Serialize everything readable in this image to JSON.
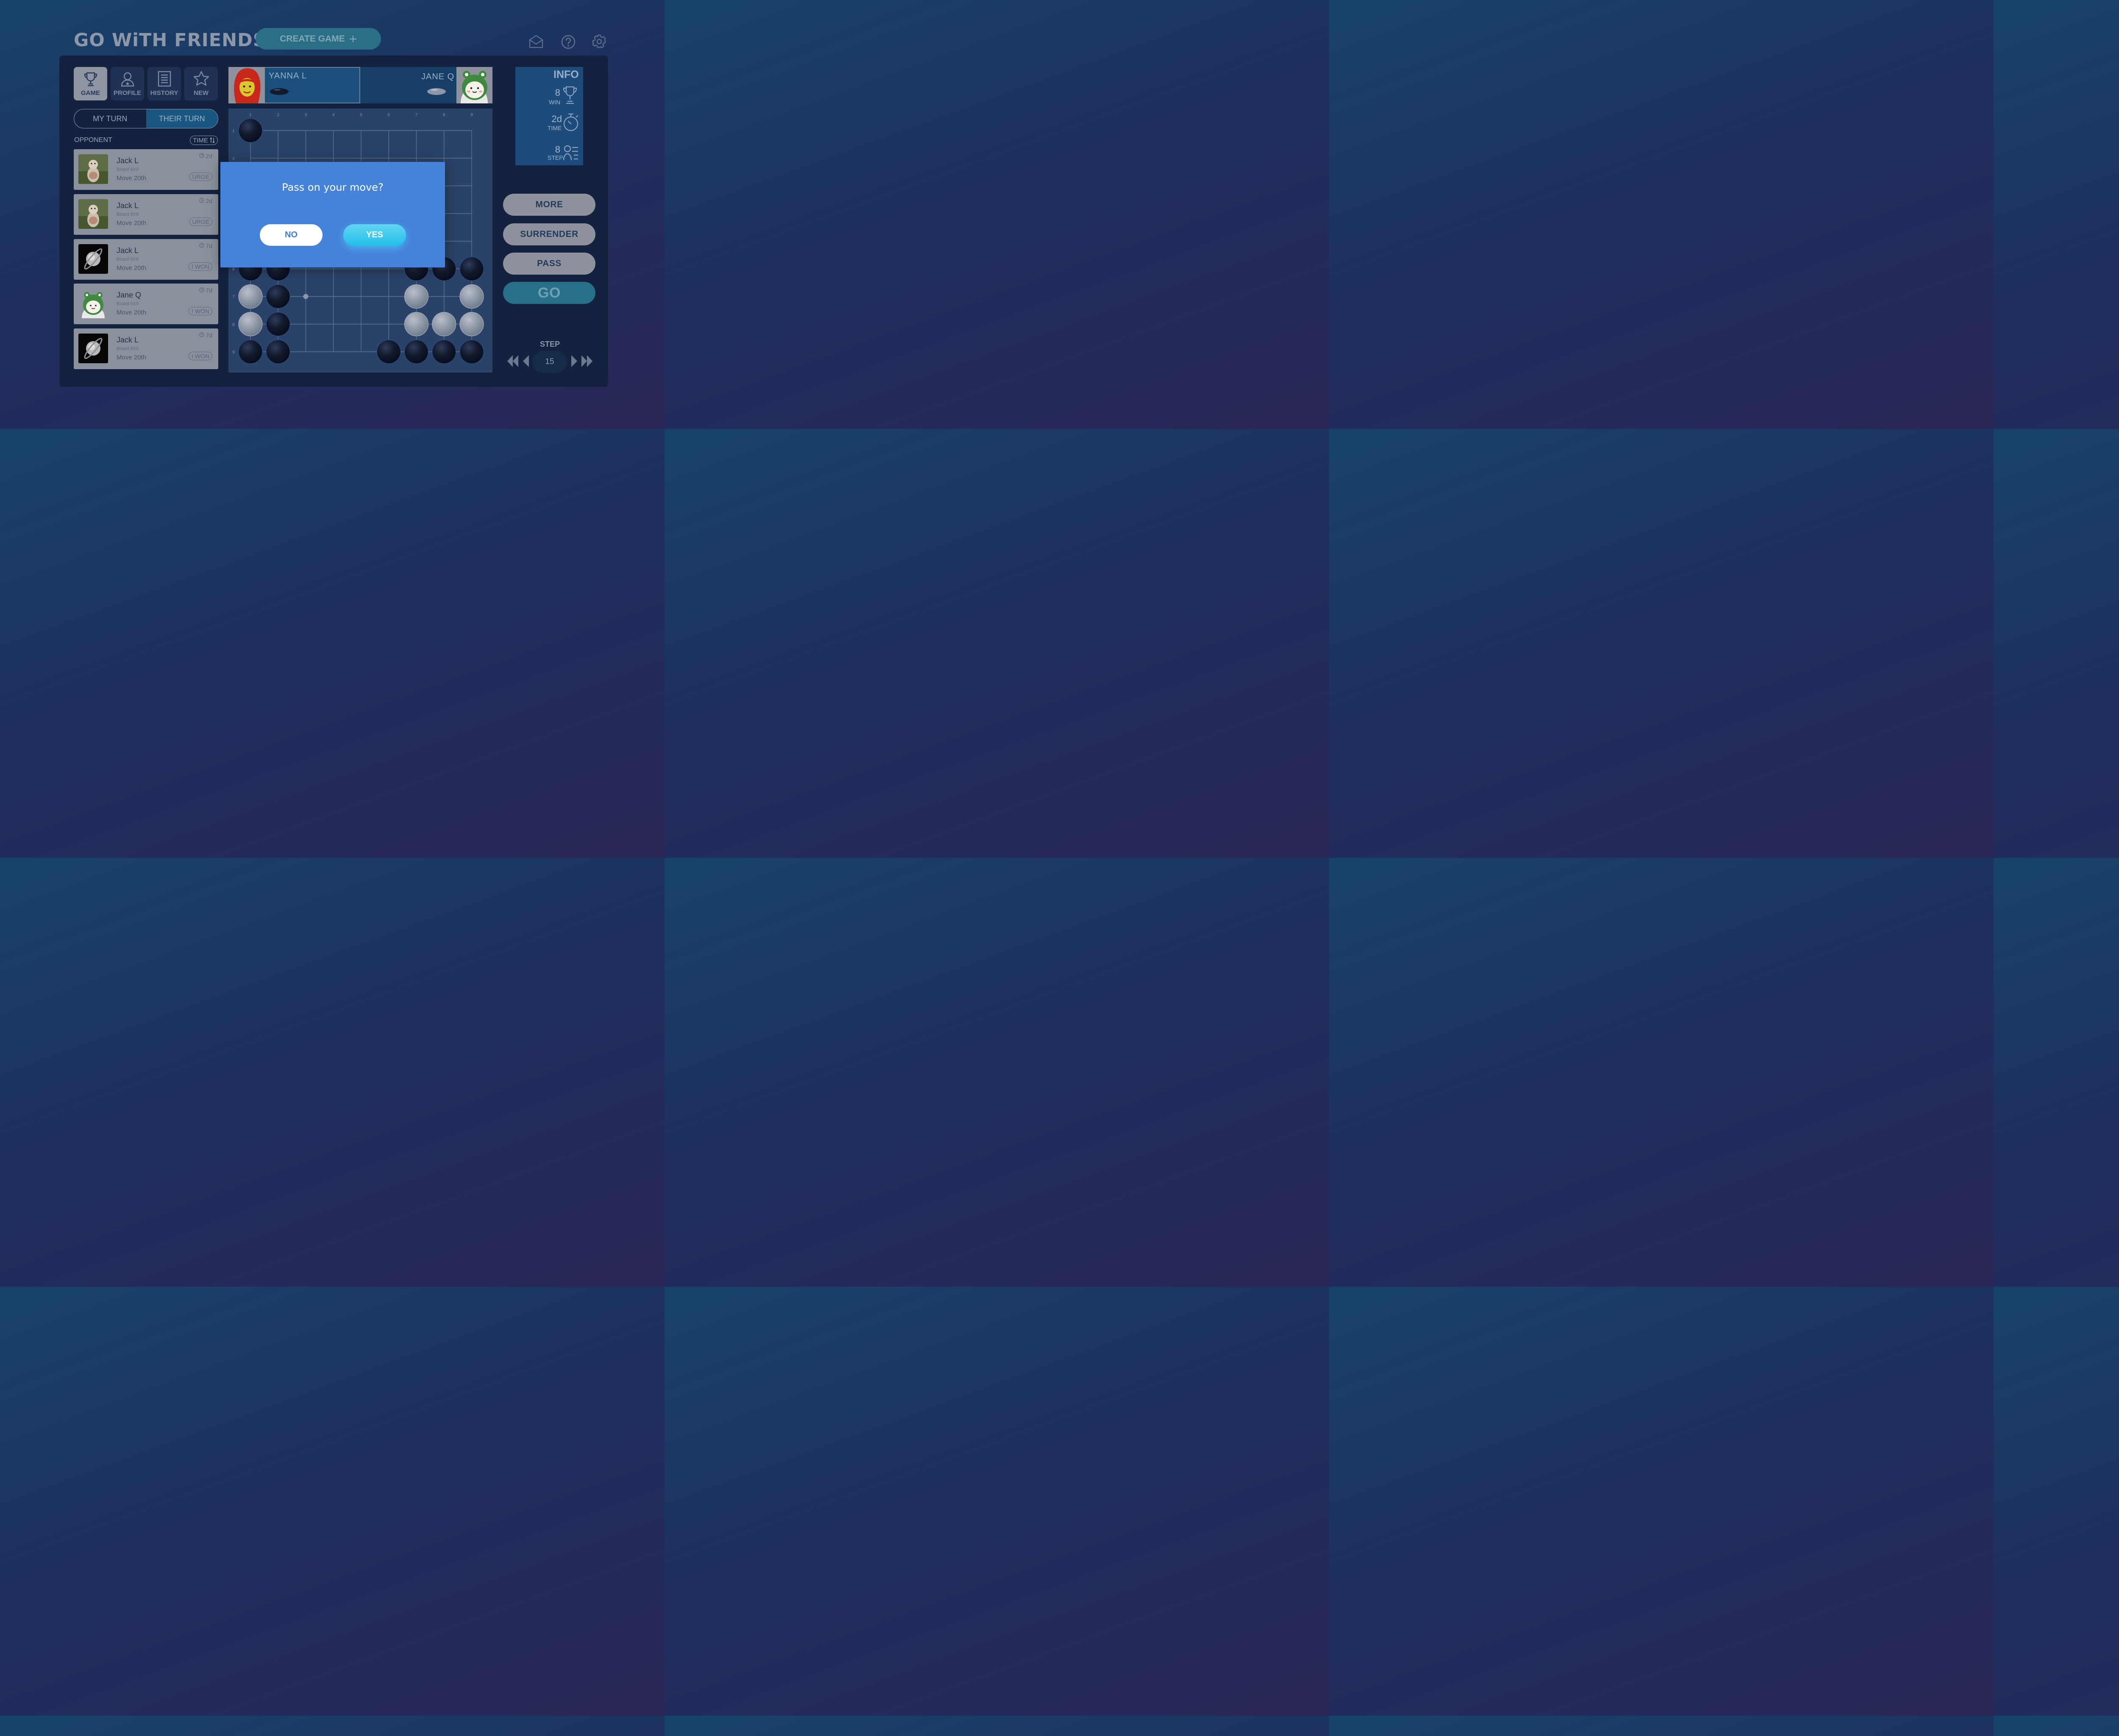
{
  "app": {
    "title": "GO WiTH FRIENDS",
    "create_label": "CREATE GAME",
    "create_icon": "plus-icon"
  },
  "top_icons": [
    "mail-icon",
    "help-icon",
    "settings-icon"
  ],
  "tabs": [
    {
      "label": "GAME",
      "icon": "trophy-icon",
      "active": true
    },
    {
      "label": "PROFILE",
      "icon": "person-icon",
      "active": false
    },
    {
      "label": "HISTORY",
      "icon": "document-icon",
      "active": false
    },
    {
      "label": "NEW",
      "icon": "star-icon",
      "active": false
    }
  ],
  "turn_toggle": {
    "my_turn": "MY TURN",
    "their_turn": "THEIR TURN",
    "selected": "THEIR TURN"
  },
  "list": {
    "opponent_label": "OPPONENT",
    "sort_label": "TIME"
  },
  "games": [
    {
      "name": "Jack L",
      "board": "Board 9X9",
      "move": "Move 20th",
      "time": "2d",
      "status": "URGE",
      "avatar": "dog"
    },
    {
      "name": "Jack L",
      "board": "Board 9X9",
      "move": "Move 20th",
      "time": "2d",
      "status": "URGE",
      "avatar": "dog"
    },
    {
      "name": "Jack L",
      "board": "Board 9X9",
      "move": "Move 20th",
      "time": "7d",
      "status": "I WON",
      "avatar": "planet"
    },
    {
      "name": "Jane Q",
      "board": "Board 9X9",
      "move": "Move 20th",
      "time": "7d",
      "status": "I WON",
      "avatar": "frog"
    },
    {
      "name": "Jack L",
      "board": "Board 9X9",
      "move": "Move 20th",
      "time": "7d",
      "status": "I WON",
      "avatar": "planet"
    }
  ],
  "players": {
    "left": {
      "name": "YANNA L",
      "stone": "black"
    },
    "right": {
      "name": "JANE Q",
      "stone": "white"
    }
  },
  "board": {
    "size": 9,
    "col_labels": [
      "1",
      "2",
      "3",
      "4",
      "5",
      "6",
      "7",
      "8",
      "9"
    ],
    "row_labels": [
      "1",
      "2",
      "3",
      "4",
      "5",
      "6",
      "7",
      "8",
      "9"
    ],
    "stones": [
      {
        "col": 1,
        "row": 1,
        "color": "black"
      },
      {
        "col": 1,
        "row": 6,
        "color": "black"
      },
      {
        "col": 2,
        "row": 6,
        "color": "black"
      },
      {
        "col": 7,
        "row": 6,
        "color": "black"
      },
      {
        "col": 8,
        "row": 6,
        "color": "black"
      },
      {
        "col": 9,
        "row": 6,
        "color": "black"
      },
      {
        "col": 1,
        "row": 7,
        "color": "white"
      },
      {
        "col": 2,
        "row": 7,
        "color": "black"
      },
      {
        "col": 7,
        "row": 7,
        "color": "white"
      },
      {
        "col": 9,
        "row": 7,
        "color": "white"
      },
      {
        "col": 1,
        "row": 8,
        "color": "white"
      },
      {
        "col": 2,
        "row": 8,
        "color": "black"
      },
      {
        "col": 7,
        "row": 8,
        "color": "white"
      },
      {
        "col": 8,
        "row": 8,
        "color": "white"
      },
      {
        "col": 9,
        "row": 8,
        "color": "white"
      },
      {
        "col": 1,
        "row": 9,
        "color": "black"
      },
      {
        "col": 2,
        "row": 9,
        "color": "black"
      },
      {
        "col": 6,
        "row": 9,
        "color": "black"
      },
      {
        "col": 7,
        "row": 9,
        "color": "black"
      },
      {
        "col": 8,
        "row": 9,
        "color": "black"
      },
      {
        "col": 9,
        "row": 9,
        "color": "black"
      }
    ],
    "marker": {
      "col": 3,
      "row": 7
    }
  },
  "info": {
    "title": "INFO",
    "win": {
      "value": "8",
      "label": "WIN",
      "icon": "trophy-icon"
    },
    "time": {
      "value": "2d",
      "label": "TIME",
      "icon": "stopwatch-icon"
    },
    "step": {
      "value": "8",
      "label": "STEP",
      "icon": "steps-icon"
    }
  },
  "actions": {
    "more": "MORE",
    "surrender": "SURRENDER",
    "pass": "PASS",
    "go": "GO"
  },
  "stepper": {
    "label": "STEP",
    "value": "15"
  },
  "dialog": {
    "question": "Pass on your move?",
    "no": "NO",
    "yes": "YES"
  }
}
